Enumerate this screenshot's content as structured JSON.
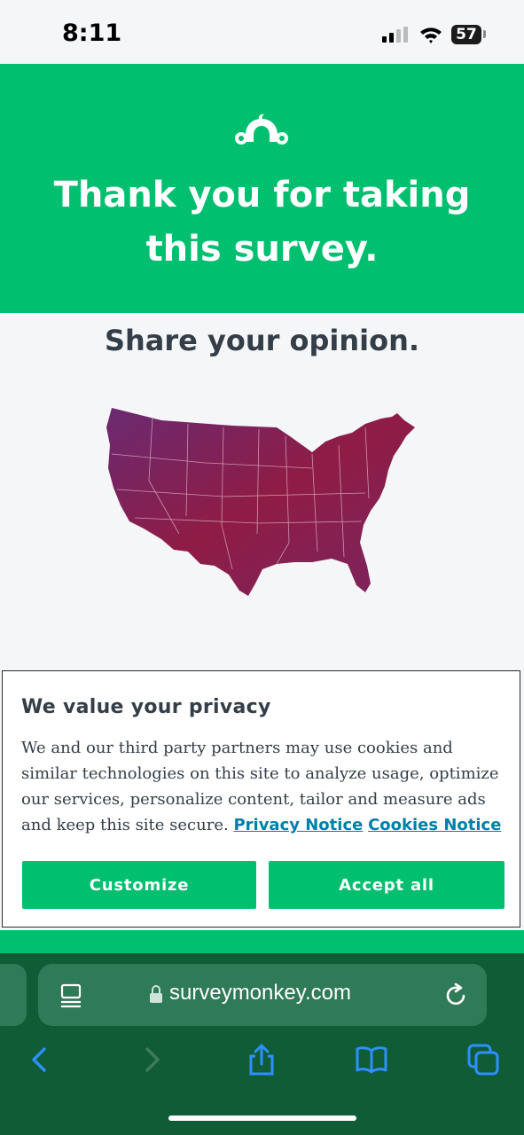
{
  "status_bar": {
    "time": "8:11",
    "battery": "57"
  },
  "hero": {
    "title": "Thank you for taking this survey.",
    "logo_icon": "surveymonkey-logo-icon",
    "background": "#00bf6f"
  },
  "main": {
    "heading": "Share your opinion.",
    "image": "us-map-illustration"
  },
  "privacy_banner": {
    "title": "We value your privacy",
    "body": "We and our third party partners may use cookies and similar technologies on this site to analyze usage, optimize our services, personalize content, tailor and measure ads and keep this site secure.",
    "privacy_link": "Privacy Notice",
    "cookies_link": "Cookies Notice",
    "customize_label": "Customize",
    "accept_label": "Accept all"
  },
  "browser": {
    "domain": "surveymonkey.com",
    "icons": [
      "reader-icon",
      "lock-icon",
      "reload-icon",
      "back-icon",
      "forward-icon",
      "share-icon",
      "bookmarks-icon",
      "tabs-icon"
    ]
  },
  "colors": {
    "brand_green": "#00bf6f",
    "toolbar_green": "#0f5c37",
    "link": "#007faa",
    "text": "#333e48"
  }
}
